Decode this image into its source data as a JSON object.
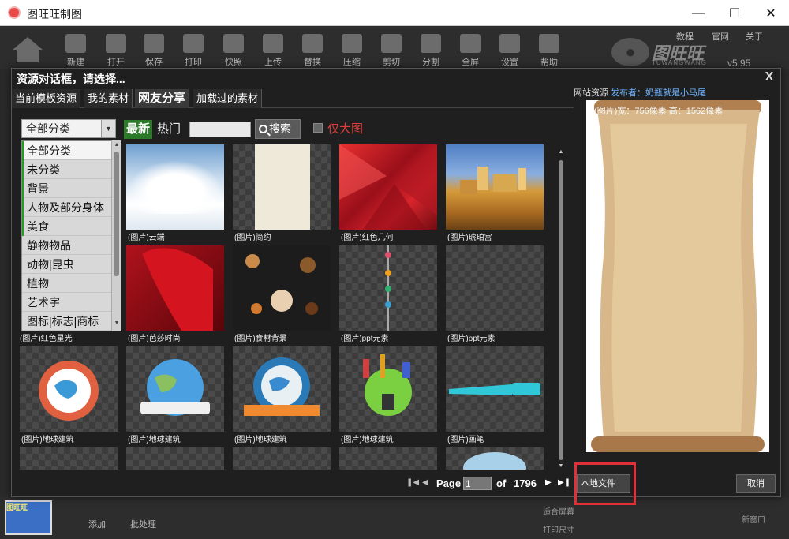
{
  "window": {
    "title": "图旺旺制图"
  },
  "toolbar": {
    "items": [
      "新建",
      "打开",
      "保存",
      "打印",
      "快照",
      "上传",
      "替换",
      "压缩",
      "剪切",
      "分割",
      "全屏",
      "设置",
      "帮助"
    ],
    "top_links": [
      "教程",
      "官网",
      "关于"
    ],
    "brand": "图旺旺",
    "brand_en": "TUWANGWANG",
    "version": "v5.95"
  },
  "bottom": {
    "thumb_label": "图旺旺",
    "add": "添加",
    "batch": "批处理",
    "fit": "适合屏幕",
    "print_size": "打印尺寸",
    "new_window": "新窗口"
  },
  "dialog": {
    "title": "资源对话框，请选择...",
    "close": "X",
    "tabs": [
      "当前模板资源",
      "我的素材",
      "网友分享",
      "加载过的素材"
    ],
    "active_tab": 2,
    "filter": {
      "category_selected": "全部分类",
      "latest": "最新",
      "hot": "热门",
      "search_value": "",
      "search_button": "搜索",
      "big_only": "仅大图"
    },
    "categories": [
      "全部分类",
      "未分类",
      "背景",
      "人物及部分身体",
      "美食",
      "静物物品",
      "动物|昆虫",
      "植物",
      "艺术字",
      "图标|标志|商标"
    ],
    "grid": [
      {
        "caption": "(图片)云端"
      },
      {
        "caption": "(图片)简约"
      },
      {
        "caption": "(图片)红色几何"
      },
      {
        "caption": "(图片)琥珀宫"
      },
      {
        "caption": "(图片)红色星光"
      },
      {
        "caption": "(图片)芭莎时尚"
      },
      {
        "caption": "(图片)食材背景"
      },
      {
        "caption": "(图片)ppt元素"
      },
      {
        "caption": "(图片)ppt元素"
      },
      {
        "caption": "(图片)地球建筑"
      },
      {
        "caption": "(图片)地球建筑"
      },
      {
        "caption": "(图片)地球建筑"
      },
      {
        "caption": "(图片)地球建筑"
      },
      {
        "caption": "(图片)画笔"
      }
    ],
    "pager": {
      "label": "Page",
      "current": "1",
      "of": "of",
      "total": "1796"
    },
    "preview": {
      "source_label": "网站资源",
      "publisher": "发布者：奶瓶就是小马尾",
      "info": "(图片)宽：756像素 高：1562像素"
    },
    "local_button": "本地文件",
    "cancel_button": "取消"
  },
  "colors": {
    "accent_green": "#2a7a2a",
    "red_text": "#e23b3b",
    "link_blue": "#6fb2ff",
    "highlight_red": "#e0303a"
  }
}
